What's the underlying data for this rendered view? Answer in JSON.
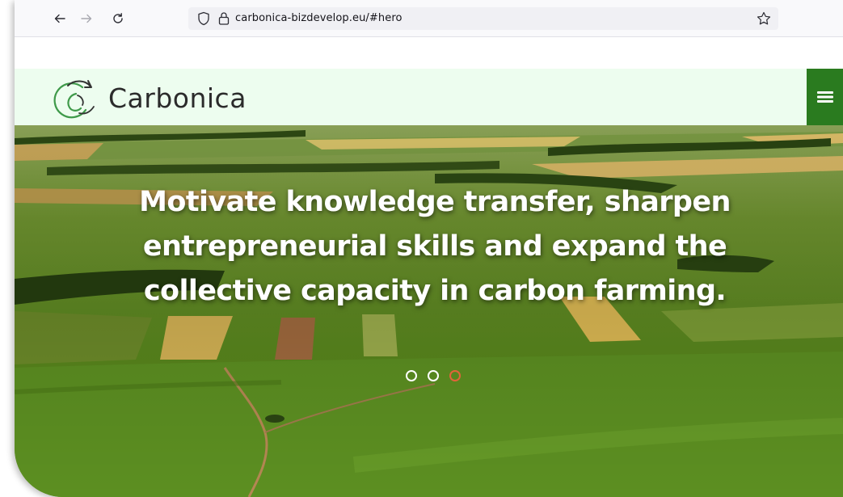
{
  "browser": {
    "url": "carbonica-bizdevelop.eu/#hero",
    "icons": {
      "back": "arrow-left-icon",
      "forward": "arrow-right-icon",
      "reload": "reload-icon",
      "tracking": "shield-icon",
      "lock": "lock-icon",
      "bookmark": "star-icon"
    }
  },
  "site": {
    "brand": "Carbonica",
    "colors": {
      "header_bg": "#edfdef",
      "menu_button": "#2a7b1f",
      "active_dot": "#e2643a"
    },
    "menu_icon": "hamburger-menu-icon"
  },
  "hero": {
    "lines": [
      "Motivate knowledge transfer, sharpen",
      "entrepreneurial skills and expand the",
      "collective capacity in carbon farming."
    ],
    "slides": [
      {
        "active": false
      },
      {
        "active": false
      },
      {
        "active": true
      }
    ]
  }
}
